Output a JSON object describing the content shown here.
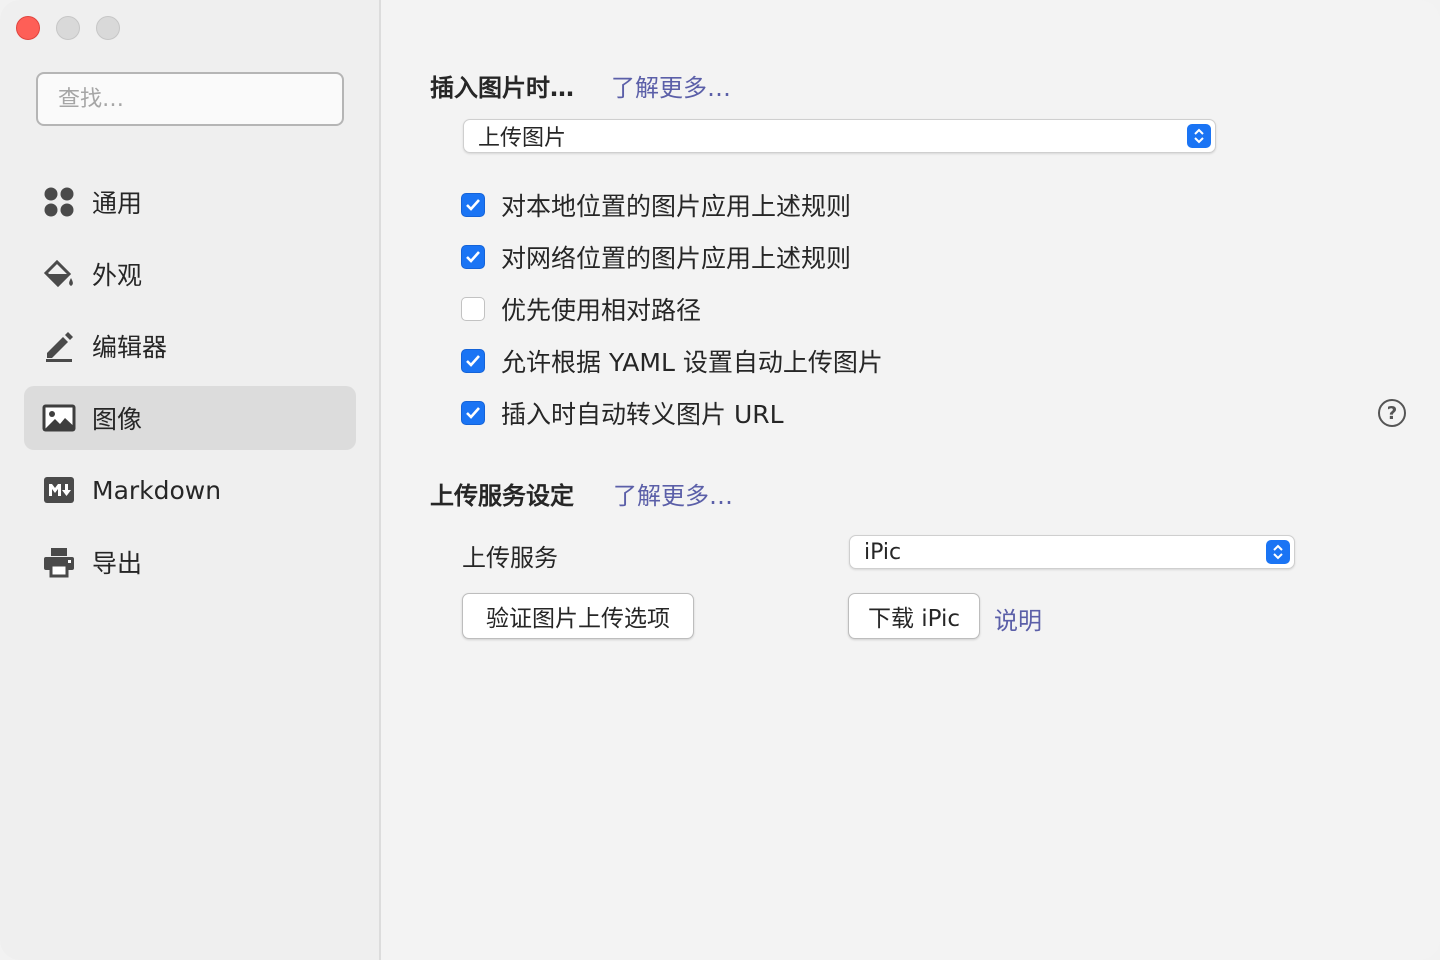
{
  "window": {
    "traffic_lights": [
      "close",
      "minimize",
      "zoom"
    ]
  },
  "sidebar": {
    "search": {
      "placeholder": "查找…",
      "value": ""
    },
    "items": [
      {
        "label": "通用",
        "icon": "grid-icon",
        "active": false
      },
      {
        "label": "外观",
        "icon": "paint-bucket-icon",
        "active": false
      },
      {
        "label": "编辑器",
        "icon": "pencil-icon",
        "active": false
      },
      {
        "label": "图像",
        "icon": "image-icon",
        "active": true
      },
      {
        "label": "Markdown",
        "icon": "markdown-icon",
        "active": false
      },
      {
        "label": "导出",
        "icon": "printer-icon",
        "active": false
      }
    ]
  },
  "image_section": {
    "title": "插入图片时…",
    "learn_more": "了解更多…",
    "insert_action": "上传图片",
    "options": [
      {
        "label": "对本地位置的图片应用上述规则",
        "checked": true
      },
      {
        "label": "对网络位置的图片应用上述规则",
        "checked": true
      },
      {
        "label": "优先使用相对路径",
        "checked": false
      },
      {
        "label": "允许根据 YAML 设置自动上传图片",
        "checked": true
      },
      {
        "label": "插入时自动转义图片 URL",
        "checked": true
      }
    ],
    "help_symbol": "?"
  },
  "upload_section": {
    "title": "上传服务设定",
    "learn_more": "了解更多…",
    "service_label": "上传服务",
    "service_value": "iPic",
    "verify_button": "验证图片上传选项",
    "download_button": "下载 iPic",
    "explain_link": "说明"
  },
  "colors": {
    "accent": "#1a74f4",
    "link": "#5b5fa8",
    "close": "#fe5f57",
    "sidebar_active": "#dcdcdc"
  }
}
